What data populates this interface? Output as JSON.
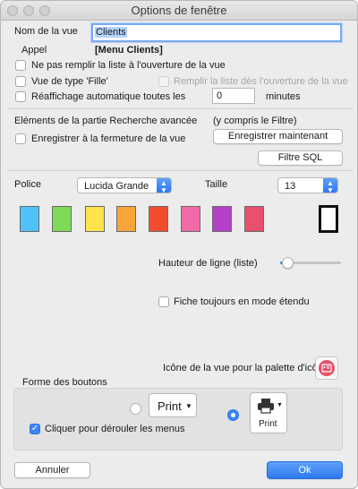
{
  "window": {
    "title": "Options de fenêtre"
  },
  "view_name": {
    "label": "Nom de la vue",
    "value": "Clients"
  },
  "appel": {
    "label": "Appel",
    "value": "[Menu Clients]"
  },
  "options": {
    "no_fill": "Ne pas remplir la liste à l'ouverture de la vue",
    "fille": "Vue de type 'Fille'",
    "fill_on_open": "Remplir la liste dès l'ouverture de la vue",
    "auto_refresh": "Réaffichage automatique toutes les",
    "refresh_value": "0",
    "minutes": "minutes"
  },
  "search": {
    "header": "Eléments de la partie Recherche avancée",
    "filter_note": "(y compris le Filtre)",
    "save_on_close": "Enregistrer à la fermeture de la vue",
    "save_now": "Enregistrer maintenant",
    "sql_filter": "Filtre SQL"
  },
  "font": {
    "label": "Police",
    "value": "Lucida Grande",
    "size_label": "Taille",
    "size_value": "13"
  },
  "colors": {
    "swatches": [
      "#4fc3f7",
      "#7ed957",
      "#ffe34d",
      "#f7a43a",
      "#f04e2c",
      "#f06aa8",
      "#b43fc9",
      "#e8506c",
      "#ffffff"
    ],
    "accent": "#3a86f5"
  },
  "row_height": {
    "label": "Hauteur de ligne (liste)",
    "level": 0.12
  },
  "extended": {
    "label": "Fiche toujours en mode étendu"
  },
  "palette_icon": {
    "label": "Icône de la vue pour la palette d'icônes",
    "icon": "id-card-icon"
  },
  "buttons_shape": {
    "label": "Forme des boutons",
    "text_option": "Print",
    "icon_option": "Print",
    "scroll_menus": "Cliquer pour dérouler les menus"
  },
  "footer": {
    "cancel": "Annuler",
    "ok": "Ok"
  }
}
